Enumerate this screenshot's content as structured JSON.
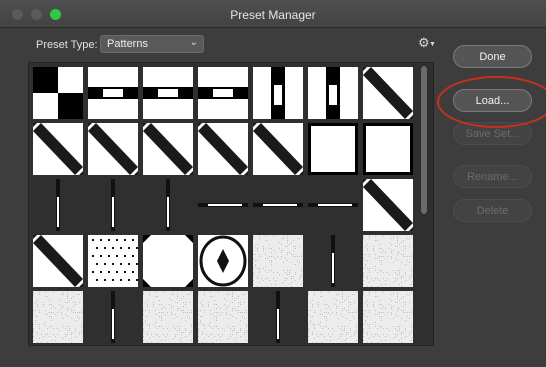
{
  "window": {
    "title": "Preset Manager"
  },
  "preset_type": {
    "label": "Preset Type:",
    "selected": "Patterns"
  },
  "icons": {
    "gear": "gear-icon",
    "dropdown": "chevron-down-icon"
  },
  "buttons": {
    "done": "Done",
    "load": "Load...",
    "save_set": "Save Set...",
    "rename": "Rename...",
    "delete": "Delete"
  },
  "annotation": {
    "color": "#c8301e"
  },
  "patterns": [
    "checker",
    "horizontal-bar",
    "horizontal-bar",
    "horizontal-bar",
    "vertical-bar",
    "vertical-bar",
    "diagonal-stripe",
    "diagonal-stripe",
    "diagonal-stripe",
    "diagonal-stripe",
    "diagonal-stripe",
    "diagonal-stripe",
    "white-square",
    "white-square",
    "vertical-line",
    "vertical-line",
    "vertical-line",
    "horizontal-line",
    "horizontal-line",
    "horizontal-line",
    "diagonal-stripe",
    "diagonal-stripe",
    "dots",
    "white-octagon",
    "diamond",
    "noise",
    "vertical-line",
    "noise",
    "noise",
    "vertical-line",
    "noise",
    "noise",
    "vertical-line",
    "noise",
    "noise"
  ]
}
